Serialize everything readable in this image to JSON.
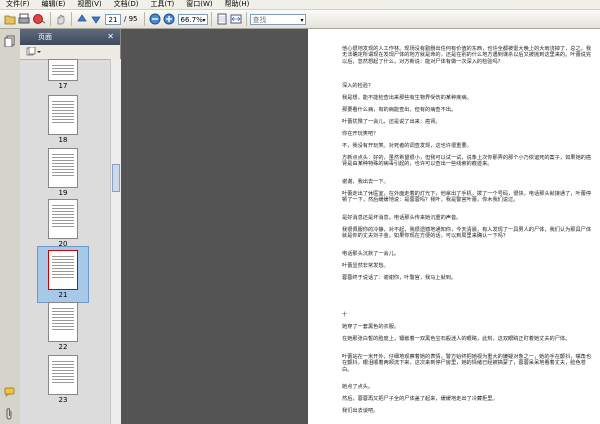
{
  "menu": [
    "文件(F)",
    "编辑(E)",
    "视图(V)",
    "文档(D)",
    "工具(T)",
    "窗口(W)",
    "帮助(H)"
  ],
  "toolbar": {
    "page_current": "21",
    "page_total": "/ 95",
    "zoom": "66.7%",
    "search_placeholder": "查找"
  },
  "sidebar": {
    "title": "页面",
    "thumbnails": [
      "17",
      "18",
      "19",
      "20",
      "21",
      "22",
      "23"
    ],
    "selected": "21"
  },
  "document": {
    "paragraphs": [
      "他心很地发现的人工作林。现场没有勤删出任何有价值的东西，也许全都被雷大晚上的大雨浇掉了，总之，我无法确定所谓现在发现尸体的地方就是命的，还是在别的什么地方遇到谋杀以后又被抛到这里来的。叶蕾说完以后，忽然想起了什么，对方新说：能对尸体有做一次深入的检验吗？",
      "深入的检验？",
      "我是想，能不能检查出来那些有生物界受伤的某种疾病。",
      "那要看什么病，有的病能查出，但有的病查不出。",
      "叶蕾犹豫了一会儿，还是说了出来：癌肾。",
      "你在开玩笑吧？",
      "不，我没有开玩笑。对死者的调查发现，这也许很重要。",
      "方新点点头：好的，虽然希望很小，但我可以试一试，说象上次你那弄的那个小乃依谊死的案子，如果她的癌肾是由某种特殊的病毒引起的，也许可以查出一些线索的痕迹来。",
      "谢谢，我出去一下。",
      "叶蕾走出了休医室，在外面走着的灯光下，他拿出了手机，拨了一个号码，很快，电话那头就接通了，叶蕾停顿了一下，然后缓缓地说：是蓉蓉吗？我叶，我是警官叶蕾，你木我们说过。",
      "是好消息还是坏消息。电话那头传来她沉重的声音。",
      "我很佩服你的冷静，对不起，我很遗憾地通知你，今天清晨，有人发现了一具男人的尸体，我们认为那具尸体就是你的丈夫刘子金。如果你现在方便的话，可以到局里来确认一下吗？",
      "电话那头沉默了一会儿。",
      "叶蕾显然非常发愁。",
      "蓉蓉终于说话了：谢谢你，叶警官，我马上就到。",
      "十",
      "她穿了一套黑色的衣服。",
      "在她那张白皙的脸庞上，镶嵌着一双黑色宝石般迷人的眼睛，此刻，这双眼睛正盯着她丈夫的尸体。",
      "叶蕾站在一米开外，仔细地观察着她的表情，警方始终把她视为重大的嫌疑对象之一，她的手在颤抖，嘴角也在颤抖，眼泪顺着两颊流下来，这次来到停尸房里，她的情绪已经被搞蒙了，蓉蓉呆呆地看着丈夫，脸色苍白。",
      "她点了点头。",
      "然后，蓉蓉再又把尸子全的尸体盖了起来，缓缓地走出了冷藏柜里。",
      "我们出去谈吧。"
    ]
  }
}
